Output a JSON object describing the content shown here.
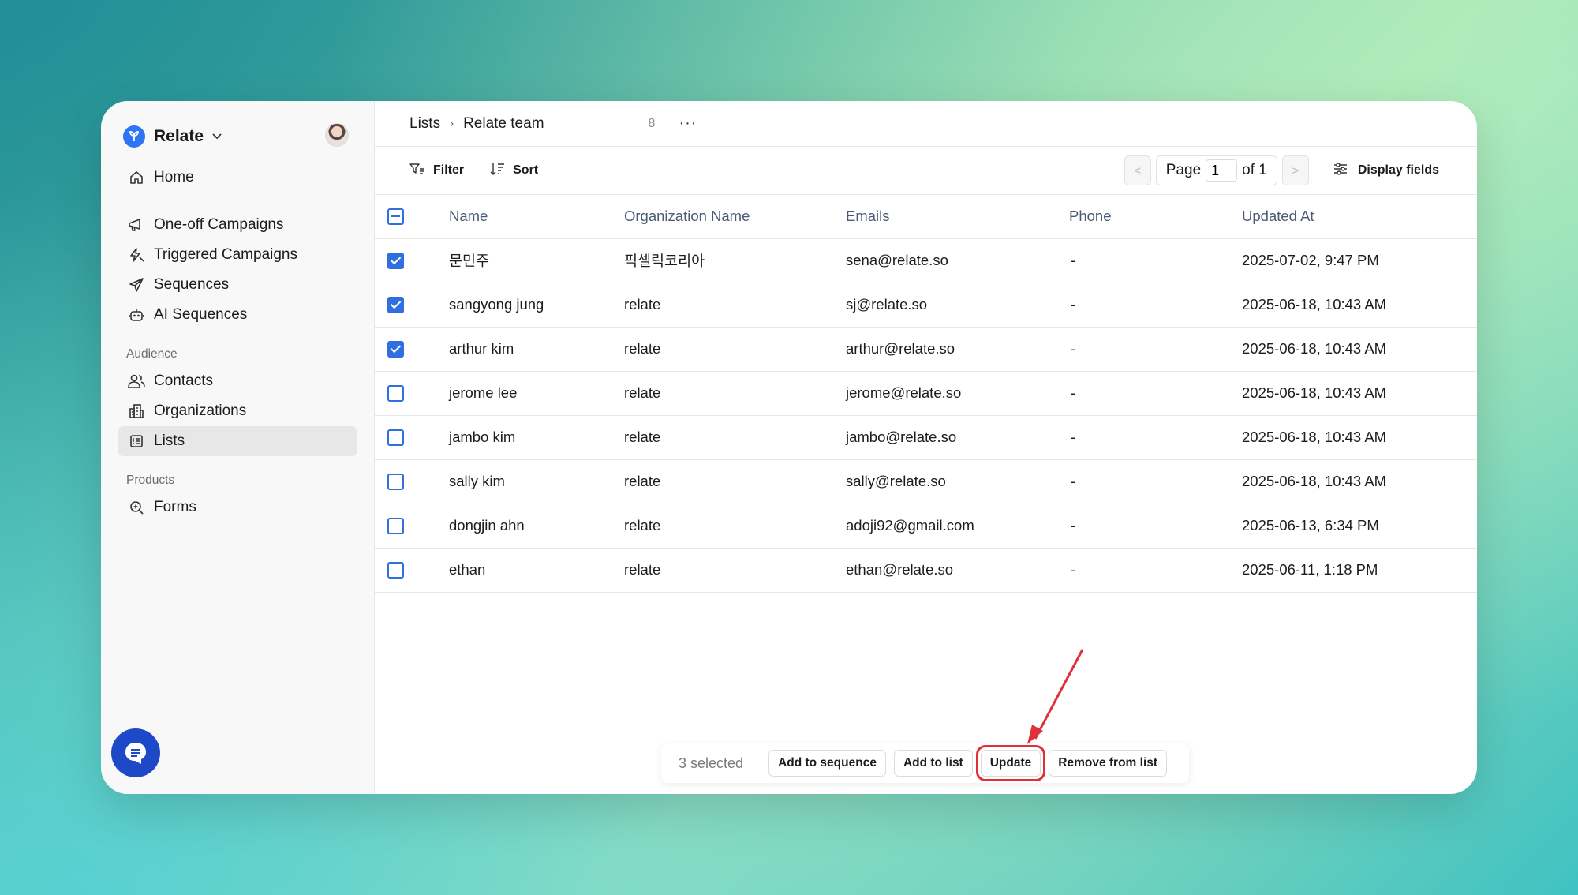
{
  "brand": {
    "name": "Relate"
  },
  "sidebar": {
    "items_top": [
      {
        "label": "Home",
        "icon": "home-icon"
      }
    ],
    "campaigns": [
      {
        "label": "One-off Campaigns",
        "icon": "megaphone-icon"
      },
      {
        "label": "Triggered Campaigns",
        "icon": "bolt-icon"
      },
      {
        "label": "Sequences",
        "icon": "send-icon"
      },
      {
        "label": "AI Sequences",
        "icon": "robot-icon"
      }
    ],
    "audience_label": "Audience",
    "audience": [
      {
        "label": "Contacts",
        "icon": "users-icon"
      },
      {
        "label": "Organizations",
        "icon": "building-icon"
      },
      {
        "label": "Lists",
        "icon": "list-icon",
        "active": true
      }
    ],
    "products_label": "Products",
    "products": [
      {
        "label": "Forms",
        "icon": "form-search-icon"
      }
    ]
  },
  "header": {
    "breadcrumb_root": "Lists",
    "breadcrumb_current": "Relate team",
    "count": "8",
    "more": "···"
  },
  "toolbar": {
    "filter": "Filter",
    "sort": "Sort",
    "page_label": "Page",
    "page_value": "1",
    "page_of": "of 1",
    "display_fields": "Display fields"
  },
  "table": {
    "columns": [
      "Name",
      "Organization Name",
      "Emails",
      "Phone",
      "Updated At"
    ],
    "rows": [
      {
        "checked": true,
        "name": "문민주",
        "org": "픽셀릭코리아",
        "email": "sena@relate.so",
        "phone": "-",
        "updated": "2025-07-02, 9:47 PM"
      },
      {
        "checked": true,
        "name": "sangyong jung",
        "org": "relate",
        "email": "sj@relate.so",
        "phone": "-",
        "updated": "2025-06-18, 10:43 AM"
      },
      {
        "checked": true,
        "name": "arthur kim",
        "org": "relate",
        "email": "arthur@relate.so",
        "phone": "-",
        "updated": "2025-06-18, 10:43 AM"
      },
      {
        "checked": false,
        "name": "jerome lee",
        "org": "relate",
        "email": "jerome@relate.so",
        "phone": "-",
        "updated": "2025-06-18, 10:43 AM"
      },
      {
        "checked": false,
        "name": "jambo kim",
        "org": "relate",
        "email": "jambo@relate.so",
        "phone": "-",
        "updated": "2025-06-18, 10:43 AM"
      },
      {
        "checked": false,
        "name": "sally kim",
        "org": "relate",
        "email": "sally@relate.so",
        "phone": "-",
        "updated": "2025-06-18, 10:43 AM"
      },
      {
        "checked": false,
        "name": "dongjin ahn",
        "org": "relate",
        "email": "adoji92@gmail.com",
        "phone": "-",
        "updated": "2025-06-13, 6:34 PM"
      },
      {
        "checked": false,
        "name": "ethan",
        "org": "relate",
        "email": "ethan@relate.so",
        "phone": "-",
        "updated": "2025-06-11, 1:18 PM"
      }
    ]
  },
  "bulk": {
    "selected": "3 selected",
    "add_to_sequence": "Add to sequence",
    "add_to_list": "Add to list",
    "update": "Update",
    "remove_from_list": "Remove from list"
  },
  "colors": {
    "accent": "#2f6fe0",
    "highlight": "#e0303a",
    "chat": "#1d49c9"
  }
}
